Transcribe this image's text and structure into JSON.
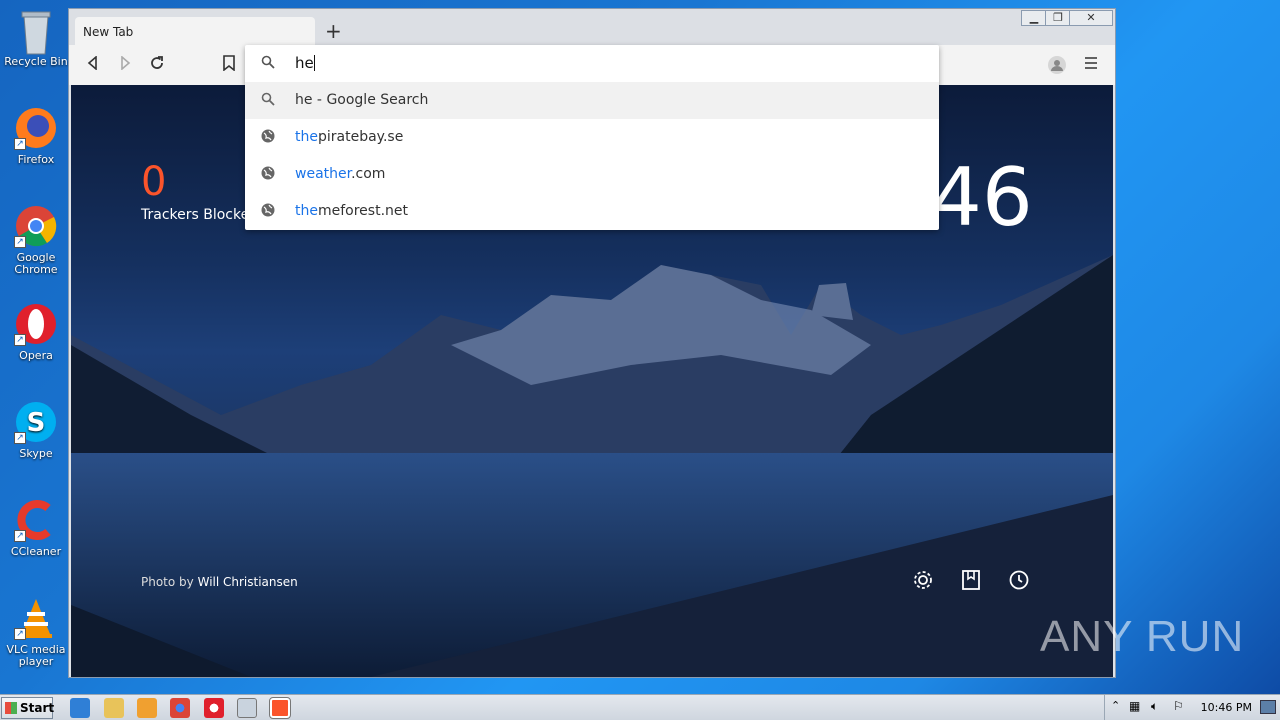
{
  "desktop": {
    "icons": [
      {
        "label": "Recycle Bin"
      },
      {
        "label": "Firefox"
      },
      {
        "label": "Google Chrome"
      },
      {
        "label": "Opera"
      },
      {
        "label": "Skype"
      },
      {
        "label": "CCleaner"
      },
      {
        "label": "VLC media player"
      }
    ]
  },
  "browser": {
    "tab_title": "New Tab",
    "new_tab_symbol": "+",
    "address_value": "he",
    "suggestions": [
      {
        "prefix": "",
        "highlight": "",
        "rest": "he - Google Search",
        "icon": "search-icon"
      },
      {
        "prefix": "",
        "highlight": "the",
        "rest": "piratebay.se",
        "icon": "globe-icon"
      },
      {
        "prefix": "",
        "highlight": "weather",
        "rest": ".com",
        "icon": "globe-icon"
      },
      {
        "prefix": "",
        "highlight": "the",
        "rest": "meforest.net",
        "icon": "globe-icon"
      }
    ]
  },
  "newtab": {
    "trackers_count": "0",
    "trackers_label": "Trackers Blocked",
    "clock": "46",
    "photo_by": "Photo by",
    "photographer": "Will Christiansen"
  },
  "taskbar": {
    "start_label": "Start",
    "time": "10:46 PM"
  },
  "watermark": "ANY RUN"
}
